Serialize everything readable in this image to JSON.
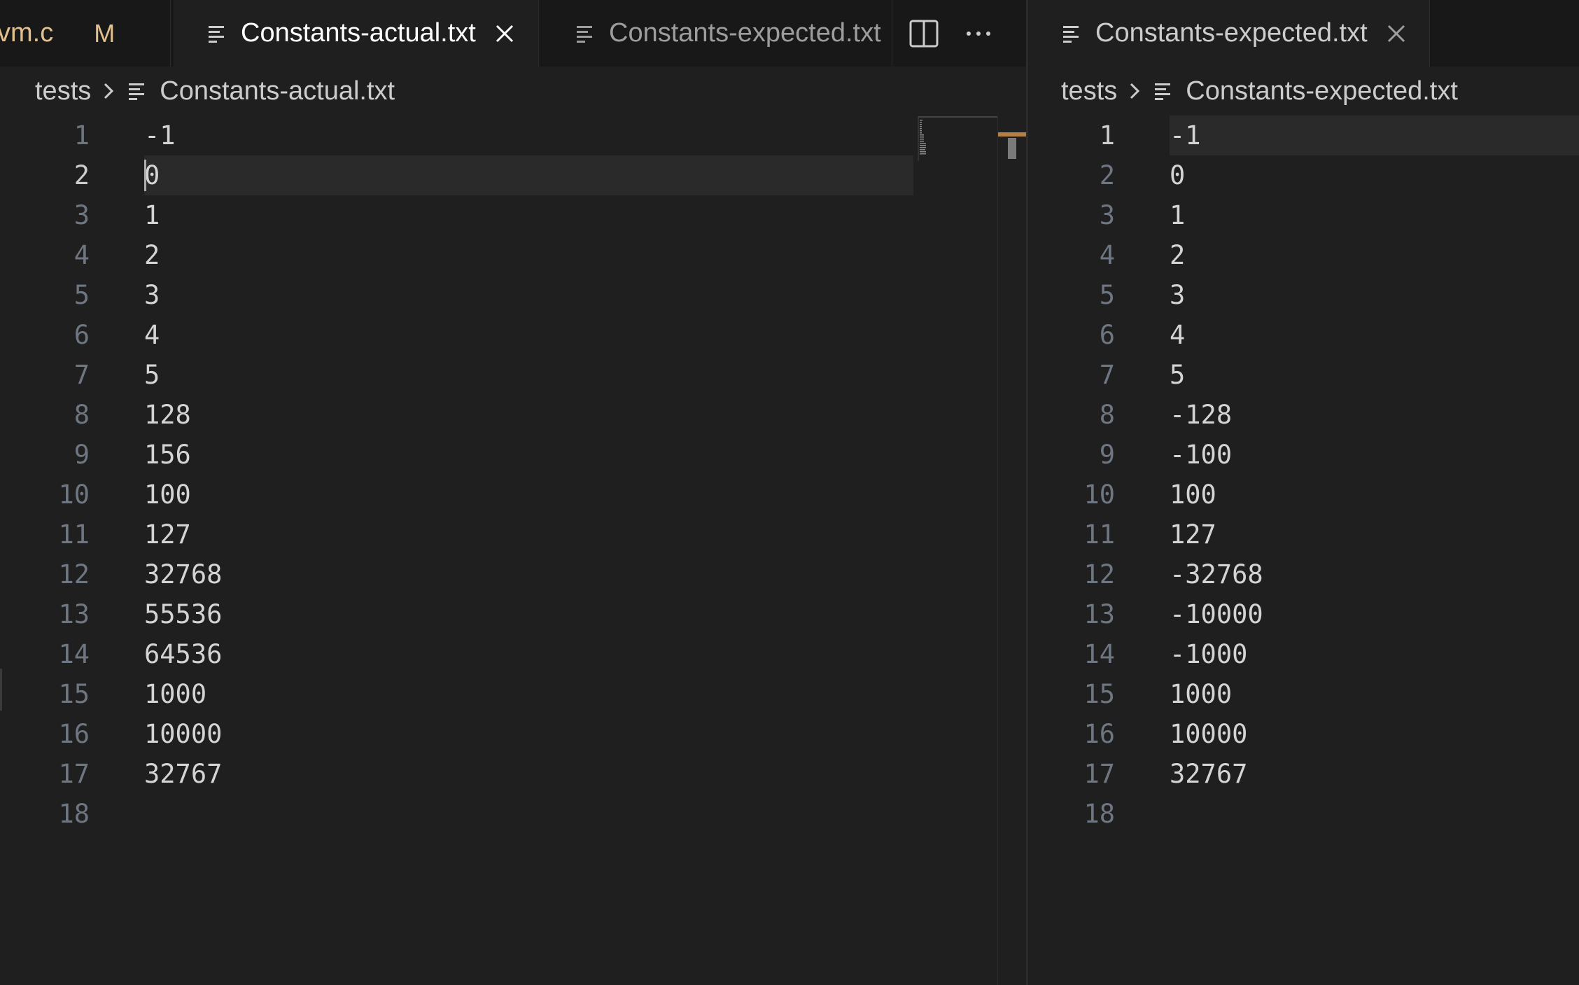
{
  "left_group": {
    "tabs": [
      {
        "label": "vm.c",
        "badge": "M",
        "active": false
      },
      {
        "label": "Constants-actual.txt",
        "active": true
      },
      {
        "label": "Constants-expected.txt",
        "active": false
      }
    ],
    "actions": [
      {
        "name": "split-editor-icon"
      },
      {
        "name": "more-actions-icon"
      }
    ],
    "breadcrumb": {
      "folder": "tests",
      "file": "Constants-actual.txt"
    },
    "lines": [
      "-1",
      "0",
      "1",
      "2",
      "3",
      "4",
      "5",
      "128",
      "156",
      "100",
      "127",
      "32768",
      "55536",
      "64536",
      "1000",
      "10000",
      "32767",
      ""
    ],
    "current_line": 2
  },
  "right_group": {
    "tabs": [
      {
        "label": "Constants-expected.txt",
        "active": true
      }
    ],
    "breadcrumb": {
      "folder": "tests",
      "file": "Constants-expected.txt"
    },
    "lines": [
      "-1",
      "0",
      "1",
      "2",
      "3",
      "4",
      "5",
      "-128",
      "-100",
      "100",
      "127",
      "-32768",
      "-10000",
      "-1000",
      "1000",
      "10000",
      "32767",
      ""
    ],
    "current_line": 1
  },
  "colors": {
    "background": "#1f1f1f",
    "tab_inactive": "#181818",
    "modified": "#e2c08d",
    "line_number": "#6e7681",
    "text": "#d4d4d4"
  },
  "icons": {
    "file": "file-lines-icon",
    "close": "close-icon",
    "breadcrumb_separator": "chevron-right-icon"
  }
}
